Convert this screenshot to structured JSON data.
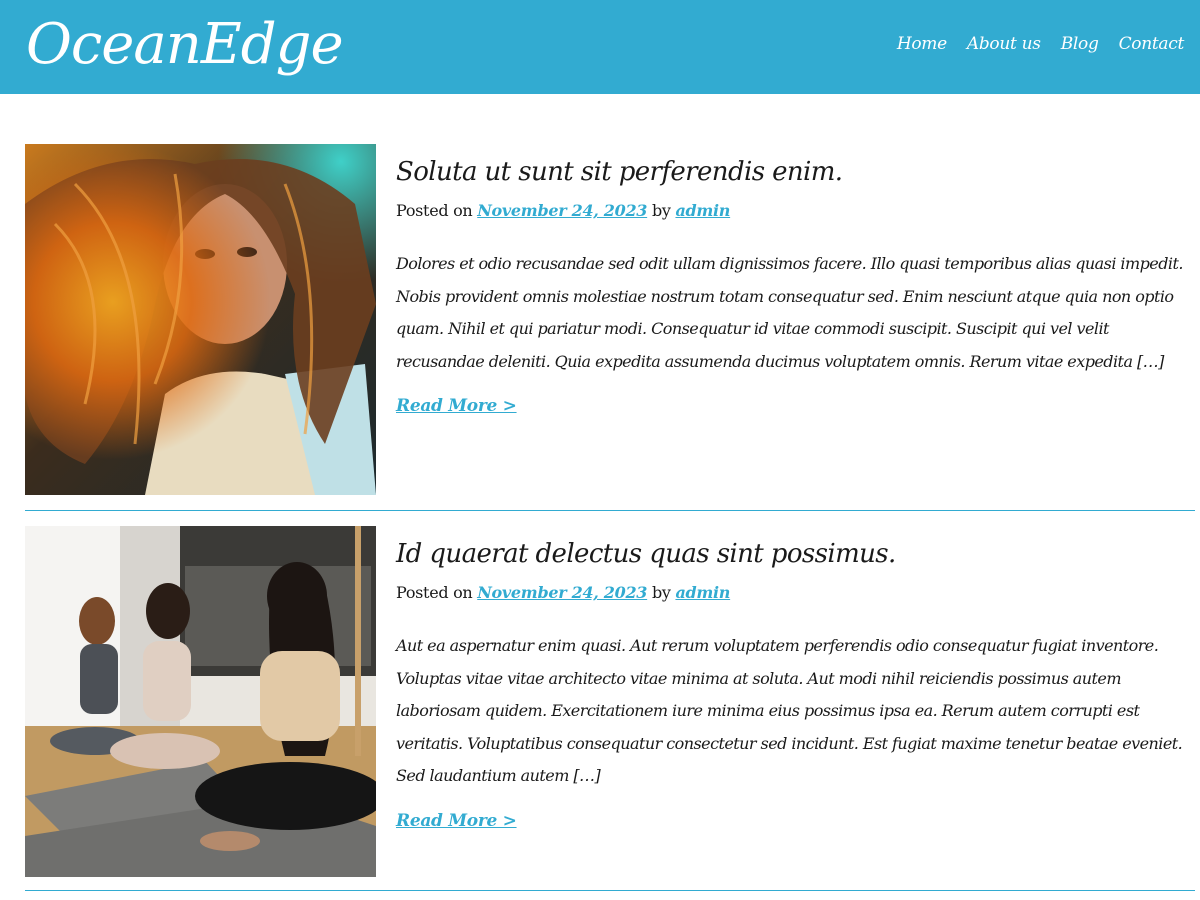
{
  "site": {
    "logo": "OceanEdge",
    "colors": {
      "brand": "#32abd1",
      "text": "#1a1a1a",
      "background": "#ffffff"
    }
  },
  "nav": {
    "items": [
      {
        "label": "Home"
      },
      {
        "label": "About us"
      },
      {
        "label": "Blog"
      },
      {
        "label": "Contact"
      }
    ]
  },
  "posts": [
    {
      "title": "Soluta ut sunt sit perferendis enim.",
      "posted_on": "Posted on",
      "date": "November 24, 2023",
      "by": "by",
      "author": "admin",
      "excerpt": "Dolores et odio recusandae sed odit ullam dignissimos facere. Illo quasi temporibus alias quasi impedit. Nobis provident omnis molestiae nostrum totam consequatur sed. Enim nesciunt atque quia non optio quam. Nihil et qui pariatur modi. Consequatur id vitae commodi suscipit. Suscipit qui vel velit recusandae deleniti. Quia expedita assumenda ducimus voluptatem omnis. Rerum vitae expedita […]",
      "read_more": "Read More >",
      "image": "portrait-woman-hair-windblown"
    },
    {
      "title": "Id quaerat delectus quas sint possimus.",
      "posted_on": "Posted on",
      "date": "November 24, 2023",
      "by": "by",
      "author": "admin",
      "excerpt": "Aut ea aspernatur enim quasi. Aut rerum voluptatem perferendis odio consequatur fugiat inventore. Voluptas vitae vitae architecto vitae minima at soluta. Aut modi nihil reiciendis possimus autem laboriosam quidem. Exercitationem iure minima eius possimus ipsa ea. Rerum autem corrupti est veritatis. Voluptatibus consequatur consectetur sed incidunt. Est fugiat maxime tenetur beatae eveniet. Sed laudantium autem […]",
      "read_more": "Read More >",
      "image": "yoga-class-meditation"
    }
  ]
}
